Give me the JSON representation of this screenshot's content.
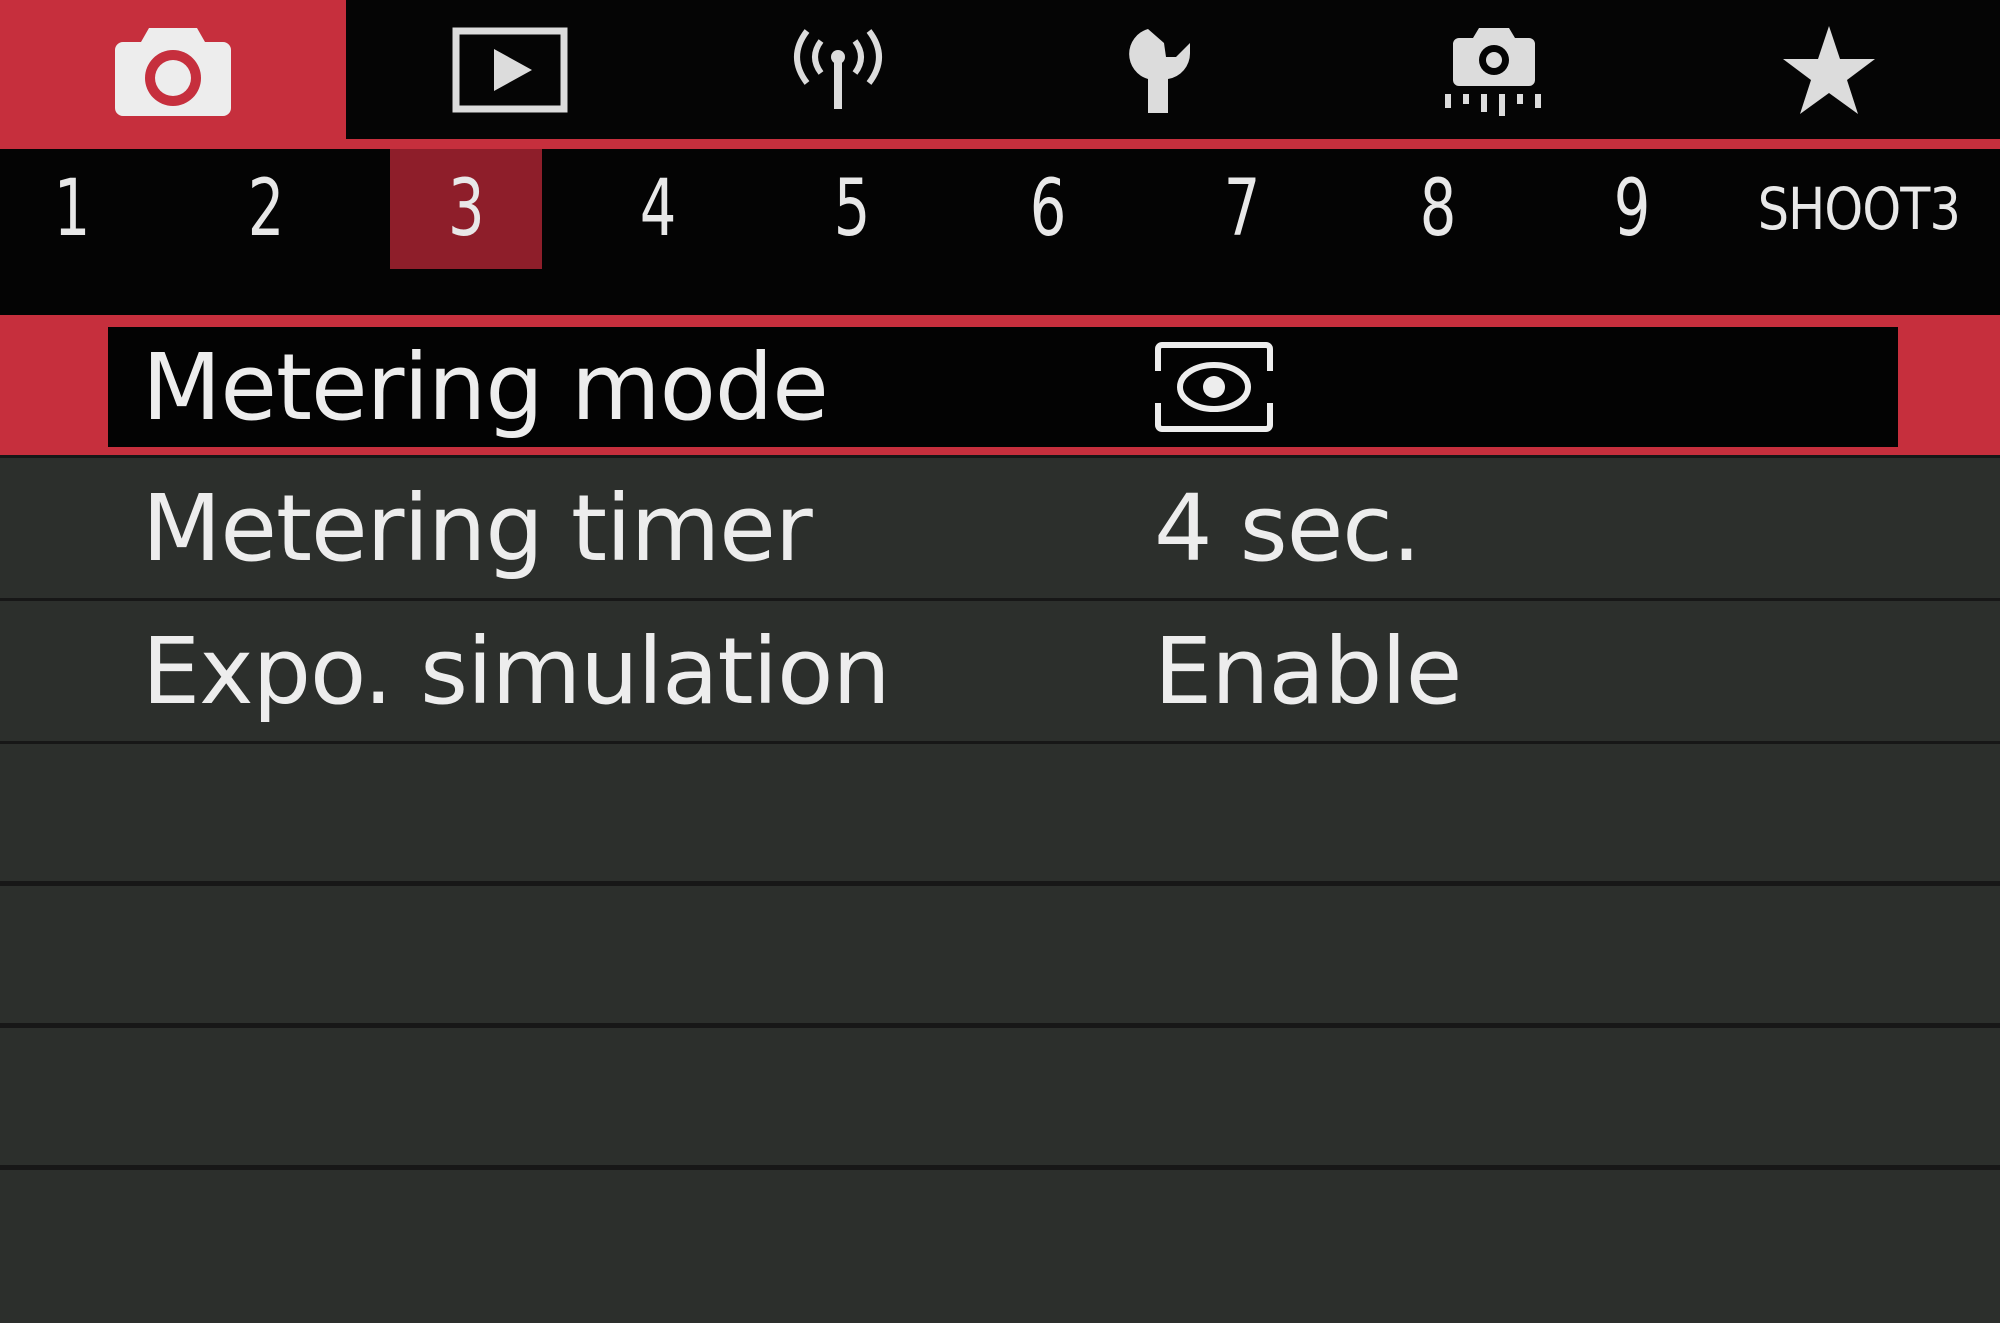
{
  "colors": {
    "accent_red": "#C62F3D",
    "page_tab_active": "#8E1E2A",
    "row_bg": "#2C2F2C",
    "text": "#EDEDED"
  },
  "categories": [
    {
      "icon": "camera-icon",
      "active": true
    },
    {
      "icon": "playback-icon",
      "active": false
    },
    {
      "icon": "wireless-icon",
      "active": false
    },
    {
      "icon": "wrench-icon",
      "active": false
    },
    {
      "icon": "custom-functions-icon",
      "active": false
    },
    {
      "icon": "star-icon",
      "active": false
    }
  ],
  "pages": {
    "numbers": [
      "1",
      "2",
      "3",
      "4",
      "5",
      "6",
      "7",
      "8",
      "9"
    ],
    "active": "3",
    "label": "SHOOT3"
  },
  "menu": {
    "items": [
      {
        "label": "Metering mode",
        "value_icon": "evaluative-metering-icon",
        "selected": true
      },
      {
        "label": "Metering timer",
        "value": "4 sec.",
        "selected": false
      },
      {
        "label": "Expo. simulation",
        "value": "Enable",
        "selected": false
      }
    ]
  }
}
